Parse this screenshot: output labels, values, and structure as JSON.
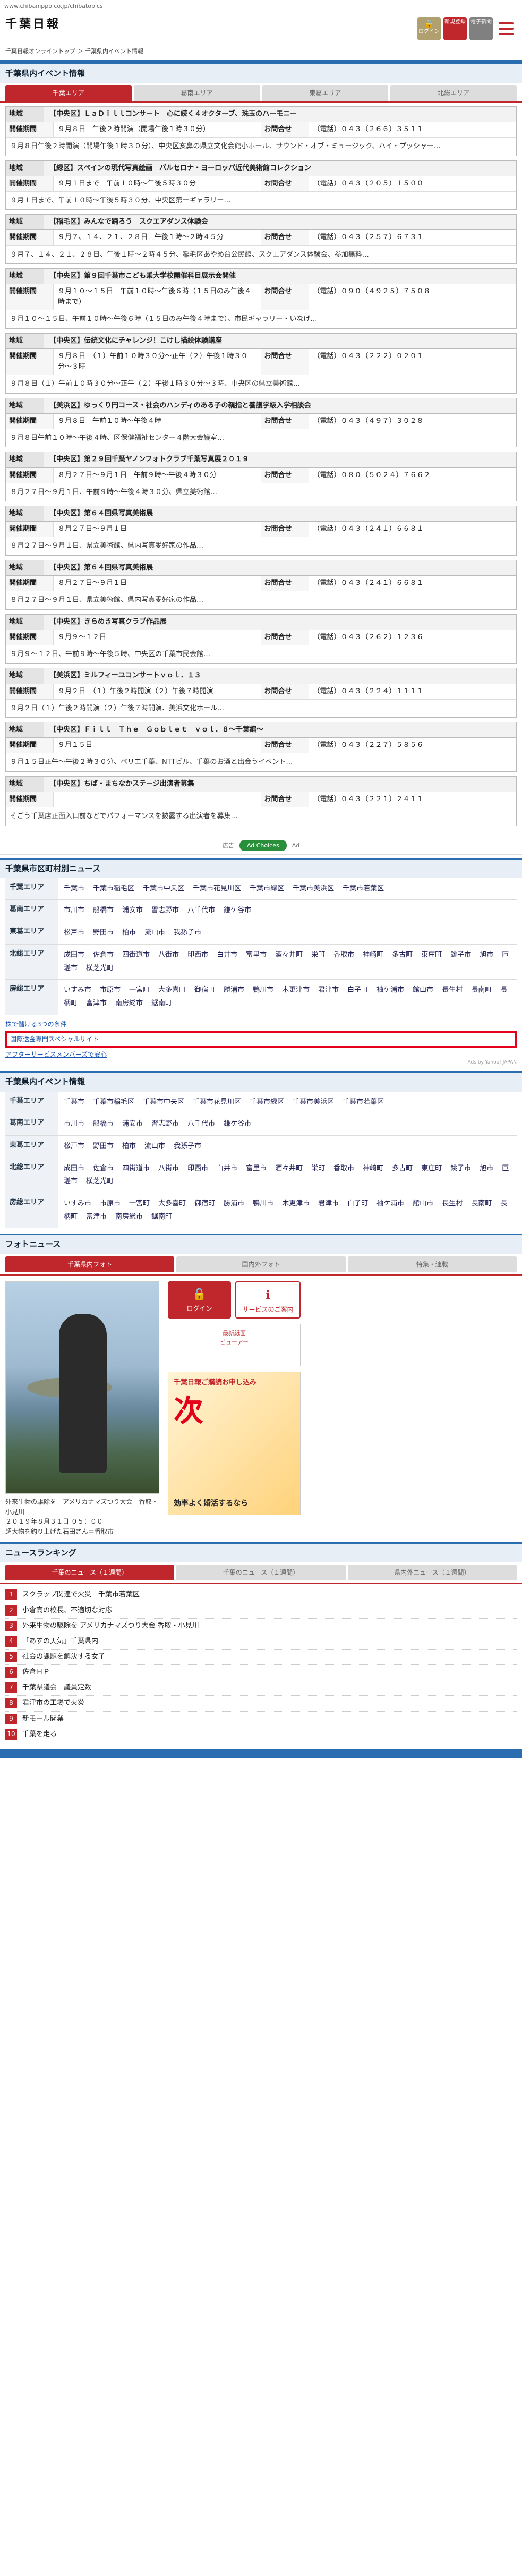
{
  "url": "www.chibanippo.co.jp/chibatopics",
  "logo": "千葉日報",
  "header_icons": [
    {
      "label": "ログイン"
    },
    {
      "label": "新規登録"
    },
    {
      "label": "電子新聞"
    }
  ],
  "breadcrumb": "千葉日報オンライントップ ＞ 千葉県内イベント情報",
  "events_section_title": "千葉県内イベント情報",
  "tabs": [
    "千葉エリア",
    "葛南エリア",
    "東葛エリア",
    "北総エリア"
  ],
  "labels": {
    "area": "地域",
    "datetime": "開催期間",
    "contact": "お問合せ"
  },
  "events": [
    {
      "area": "【中央区】",
      "title": "ＬａＤｉｌｌコンサート　心に続く４オクターブ、珠玉のハーモニー",
      "date": "９月８日",
      "time": "午後２時開演（開場午後１時３０分）",
      "contact": "（電話）０４３（２６６）３５１１",
      "body": "９月８日午後２時開演（開場午後１時３０分）、中央区亥鼻の県立文化会館小ホール、サウンド・オブ・ミュージック、ハイ・プッシャー…"
    },
    {
      "area": "【緑区】",
      "title": "スペインの現代写真絵画　バルセロナ・ヨーロッパ近代美術館コレクション",
      "date": "９月１日まで",
      "time": "午前１０時〜午後５時３０分",
      "contact": "（電話）０４３（２０５）１５００",
      "body": "９月１日まで、午前１０時〜午後５時３０分、中央区第一ギャラリー…"
    },
    {
      "area": "【稲毛区】",
      "title": "みんなで踊ろう　スクエアダンス体験会",
      "date": "９月７、１４、２１、２８日",
      "time": "午後１時〜２時４５分",
      "contact": "（電話）０４３（２５７）６７３１",
      "body": "９月７、１４、２１、２８日、午後１時〜２時４５分、稲毛区あやめ台公民館、スクエアダンス体験会、参加無料…"
    },
    {
      "area": "【中央区】",
      "title": "第９回千葉市こども乗大学校開催科目展示会開催",
      "date": "９月１０〜１５日",
      "time": "午前１０時〜午後６時（１５日のみ午後４時まで）",
      "contact": "（電話）０９０（４９２５）７５０８",
      "body": "９月１０〜１５日、午前１０時〜午後６時（１５日のみ午後４時まで）、市民ギャラリー・いなげ…"
    },
    {
      "area": "【中央区】",
      "title": "伝統文化にチャレンジ！こけし描絵体験講座",
      "date": "９月８日",
      "time": "（１）午前１０時３０分〜正午（２）午後１時３０分〜３時",
      "contact": "（電話）０４３（２２２）０２０１",
      "body": "９月８日（１）午前１０時３０分〜正午（２）午後１時３０分〜３時、中央区の県立美術館…"
    },
    {
      "area": "【美浜区】",
      "title": "ゆっくり円コース・社会のハンディのある子の親指と養護学級入学相談会",
      "date": "９月８日",
      "time": "午前１０時〜午後４時",
      "contact": "（電話）０４３（４９７）３０２８",
      "body": "９月８日午前１０時〜午後４時、区保健福祉センター４階大会議室…"
    },
    {
      "area": "【中央区】",
      "title": "第２９回千葉ヤノンフォトクラブ千葉写真展２０１９",
      "date": "８月２７日〜９月１日",
      "time": "午前９時〜午後４時３０分",
      "contact": "（電話）０８０（５０２４）７６６２",
      "body": "８月２７日〜９月１日、午前９時〜午後４時３０分、県立美術館…"
    },
    {
      "area": "【中央区】",
      "title": "第６４回県写真美術展",
      "date": "８月２７日〜９月１日",
      "time": "",
      "contact": "（電話）０４３（２４１）６６８１",
      "body": "８月２７日〜９月１日、県立美術館、県内写真愛好家の作品…"
    },
    {
      "area": "【中央区】",
      "title": "第６４回県写真美術展",
      "date": "８月２７日〜９月１日",
      "time": "",
      "contact": "（電話）０４３（２４１）６６８１",
      "body": "８月２７日〜９月１日、県立美術館、県内写真愛好家の作品…"
    },
    {
      "area": "【中央区】",
      "title": "きらめき写真クラブ作品展",
      "date": "９月９〜１２日",
      "time": "",
      "contact": "（電話）０４３（２６２）１２３６",
      "body": "９月９〜１２日、午前９時〜午後５時、中央区の千葉市民会館…"
    },
    {
      "area": "【美浜区】",
      "title": "ミルフィーユコンサートｖｏｌ．１３",
      "date": "９月２日",
      "time": "（１）午後２時開演（２）午後７時開演",
      "contact": "（電話）０４３（２２４）１１１１",
      "body": "９月２日（１）午後２時開演（２）午後７時開演、美浜文化ホール…"
    },
    {
      "area": "【中央区】",
      "title": "Ｆｉｌｌ　Ｔｈｅ　Ｇｏｂｌｅｔ　ｖｏｌ．８〜千葉編〜",
      "date": "９月１５日",
      "time": "",
      "contact": "（電話）０４３（２２７）５８５６",
      "body": "９月１５日正午〜午後２時３０分、ペリエ千葉、NTTビル、千葉のお酒と出会うイベント…"
    },
    {
      "area": "【中央区】",
      "title": "ちば・まちなかステージ出演者募集",
      "date": "",
      "time": "",
      "contact": "（電話）０４３（２２１）２４１１",
      "body": "そごう千葉店正面入口前などでパフォーマンスを披露する出演者を募集…"
    }
  ],
  "ad": {
    "left": "広告",
    "pill": "Ad Choices",
    "right": "Ad"
  },
  "city_news_title": "千葉県市区町村別ニュース",
  "regions": [
    {
      "label": "千葉エリア",
      "items": [
        "千葉市",
        "千葉市稲毛区",
        "千葉市中央区",
        "千葉市花見川区",
        "千葉市緑区",
        "千葉市美浜区",
        "千葉市若葉区"
      ]
    },
    {
      "label": "葛南エリア",
      "items": [
        "市川市",
        "船橋市",
        "浦安市",
        "習志野市",
        "八千代市",
        "鎌ケ谷市"
      ]
    },
    {
      "label": "東葛エリア",
      "items": [
        "松戸市",
        "野田市",
        "柏市",
        "流山市",
        "我孫子市"
      ]
    },
    {
      "label": "北総エリア",
      "items": [
        "成田市",
        "佐倉市",
        "四街道市",
        "八街市",
        "印西市",
        "白井市",
        "富里市",
        "酒々井町",
        "栄町",
        "香取市",
        "神崎町",
        "多古町",
        "東庄町",
        "銚子市",
        "旭市",
        "匝瑳市",
        "横芝光町"
      ]
    },
    {
      "label": "房総エリア",
      "items": [
        "いすみ市",
        "市原市",
        "一宮町",
        "大多喜町",
        "御宿町",
        "勝浦市",
        "鴨川市",
        "木更津市",
        "君津市",
        "白子町",
        "袖ケ浦市",
        "館山市",
        "長生村",
        "長南町",
        "長柄町",
        "富津市",
        "南房総市",
        "鋸南町"
      ]
    }
  ],
  "promos": [
    {
      "link": "株で儲ける3つの条件",
      "url": "",
      "desc": ""
    },
    {
      "link": "国際送金専門スペシャルサイト",
      "url": "",
      "desc": ""
    },
    {
      "link": "アフターサービスメンバーズで安心",
      "url": "",
      "desc": ""
    }
  ],
  "adsby": "Ads by Yahoo! JAPAN",
  "events2_title": "千葉県内イベント情報",
  "photo_news_title": "フォトニュース",
  "photo_tabs": [
    "千葉県内フォト",
    "国内外フォト",
    "特集・連載"
  ],
  "photo_caption": "外来生物の駆除を　アメリカナマズつり大会　香取・小見川\n２０１９年８月３１日 ０５：００\n超大物を釣り上げた石田さん＝香取市",
  "side": {
    "login": "ログイン",
    "service": "サービスのご案内",
    "news_label": "最新紙面",
    "news_sub": "ビューアー",
    "banner_title": "千葉日報ご購読お申し込み",
    "banner_big": "次",
    "banner_foot": "効率よく婚活するなら"
  },
  "ranking_title": "ニュースランキング",
  "rank_tabs": [
    "千葉のニュース（１週間）",
    "千葉のニュース（１週間）",
    "県内外ニュース（１週間）"
  ],
  "rankings": [
    "スクラップ関連で火災　千葉市若葉区",
    "小倉高の校長、不適切な対応",
    "外来生物の駆除を アメリカナマズつり大会 香取・小見川",
    "「あすの天気」千葉県内",
    "社会の課題を解決する女子",
    "佐倉ＨＰ",
    "千葉県議会　議員定数",
    "君津市の工場で火災",
    "新モール開業",
    "千葉を走る"
  ]
}
